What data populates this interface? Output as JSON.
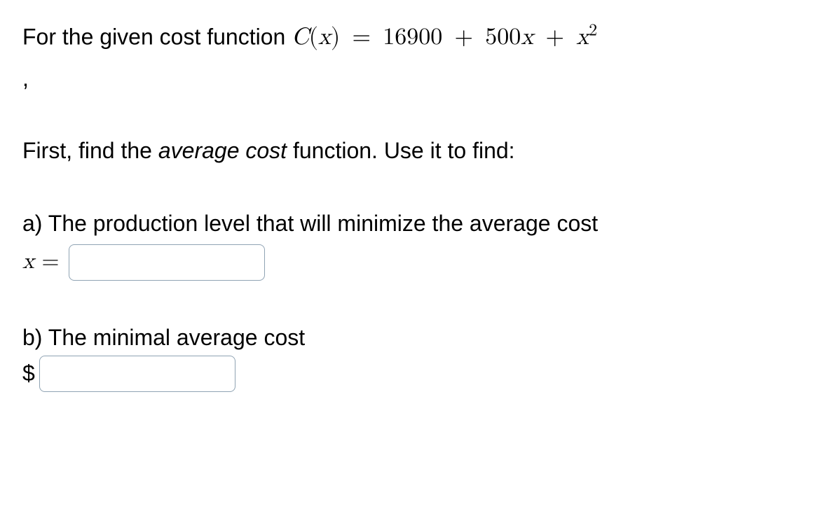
{
  "intro": {
    "prefix": "For the given cost function ",
    "func_letter": "C",
    "paren_open": "(",
    "var": "x",
    "paren_close": ")",
    "eq": " = ",
    "const": "16900",
    "plus1": " + ",
    "coef": "500",
    "var2": "x",
    "plus2": " + ",
    "var3": "x",
    "exp": "2"
  },
  "comma": ",",
  "instruction": {
    "pre": "First, find the ",
    "emph": "average cost",
    "post": " function. Use it to find:"
  },
  "part_a": {
    "prompt": "a) The production level that will minimize the average cost",
    "label_x": "x",
    "label_eq": " = ",
    "input_value": ""
  },
  "part_b": {
    "prompt": "b) The minimal average cost",
    "currency": "$",
    "input_value": ""
  }
}
